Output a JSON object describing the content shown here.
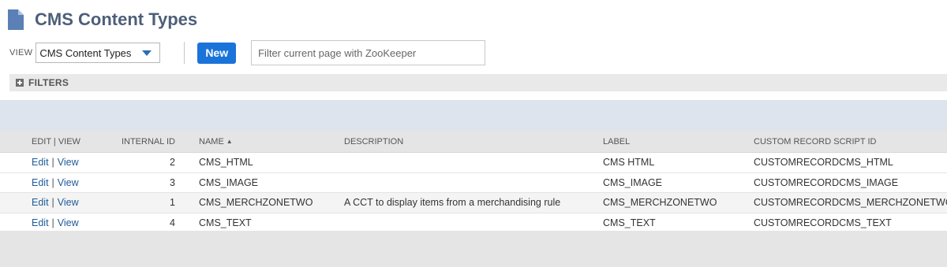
{
  "page": {
    "title": "CMS Content Types",
    "icon": "document-icon"
  },
  "view_bar": {
    "view_label": "VIEW",
    "view_selected": "CMS Content Types",
    "new_button": "New",
    "filter_placeholder": "Filter current page with ZooKeeper"
  },
  "filters": {
    "label": "FILTERS"
  },
  "table": {
    "headers": {
      "edit_view": "EDIT | VIEW",
      "internal_id": "INTERNAL ID",
      "name": "NAME",
      "description": "DESCRIPTION",
      "label": "LABEL",
      "script_id": "CUSTOM RECORD SCRIPT ID"
    },
    "sort_indicator": "▲",
    "edit_link": "Edit",
    "view_link": "View",
    "divider": "|",
    "rows": [
      {
        "internal_id": "2",
        "name": "CMS_HTML",
        "description": "",
        "label": "CMS HTML",
        "script_id": "CUSTOMRECORDCMS_HTML"
      },
      {
        "internal_id": "3",
        "name": "CMS_IMAGE",
        "description": "",
        "label": "CMS_IMAGE",
        "script_id": "CUSTOMRECORDCMS_IMAGE"
      },
      {
        "internal_id": "1",
        "name": "CMS_MERCHZONETWO",
        "description": "A CCT to display items from a merchandising rule",
        "label": "CMS_MERCHZONETWO",
        "script_id": "CUSTOMRECORDCMS_MERCHZONETWO"
      },
      {
        "internal_id": "4",
        "name": "CMS_TEXT",
        "description": "",
        "label": "CMS_TEXT",
        "script_id": "CUSTOMRECORDCMS_TEXT"
      }
    ]
  },
  "colors": {
    "title": "#4d5f79",
    "accent": "#1a73d9",
    "link": "#1f5b99",
    "band": "#dde4ee"
  }
}
